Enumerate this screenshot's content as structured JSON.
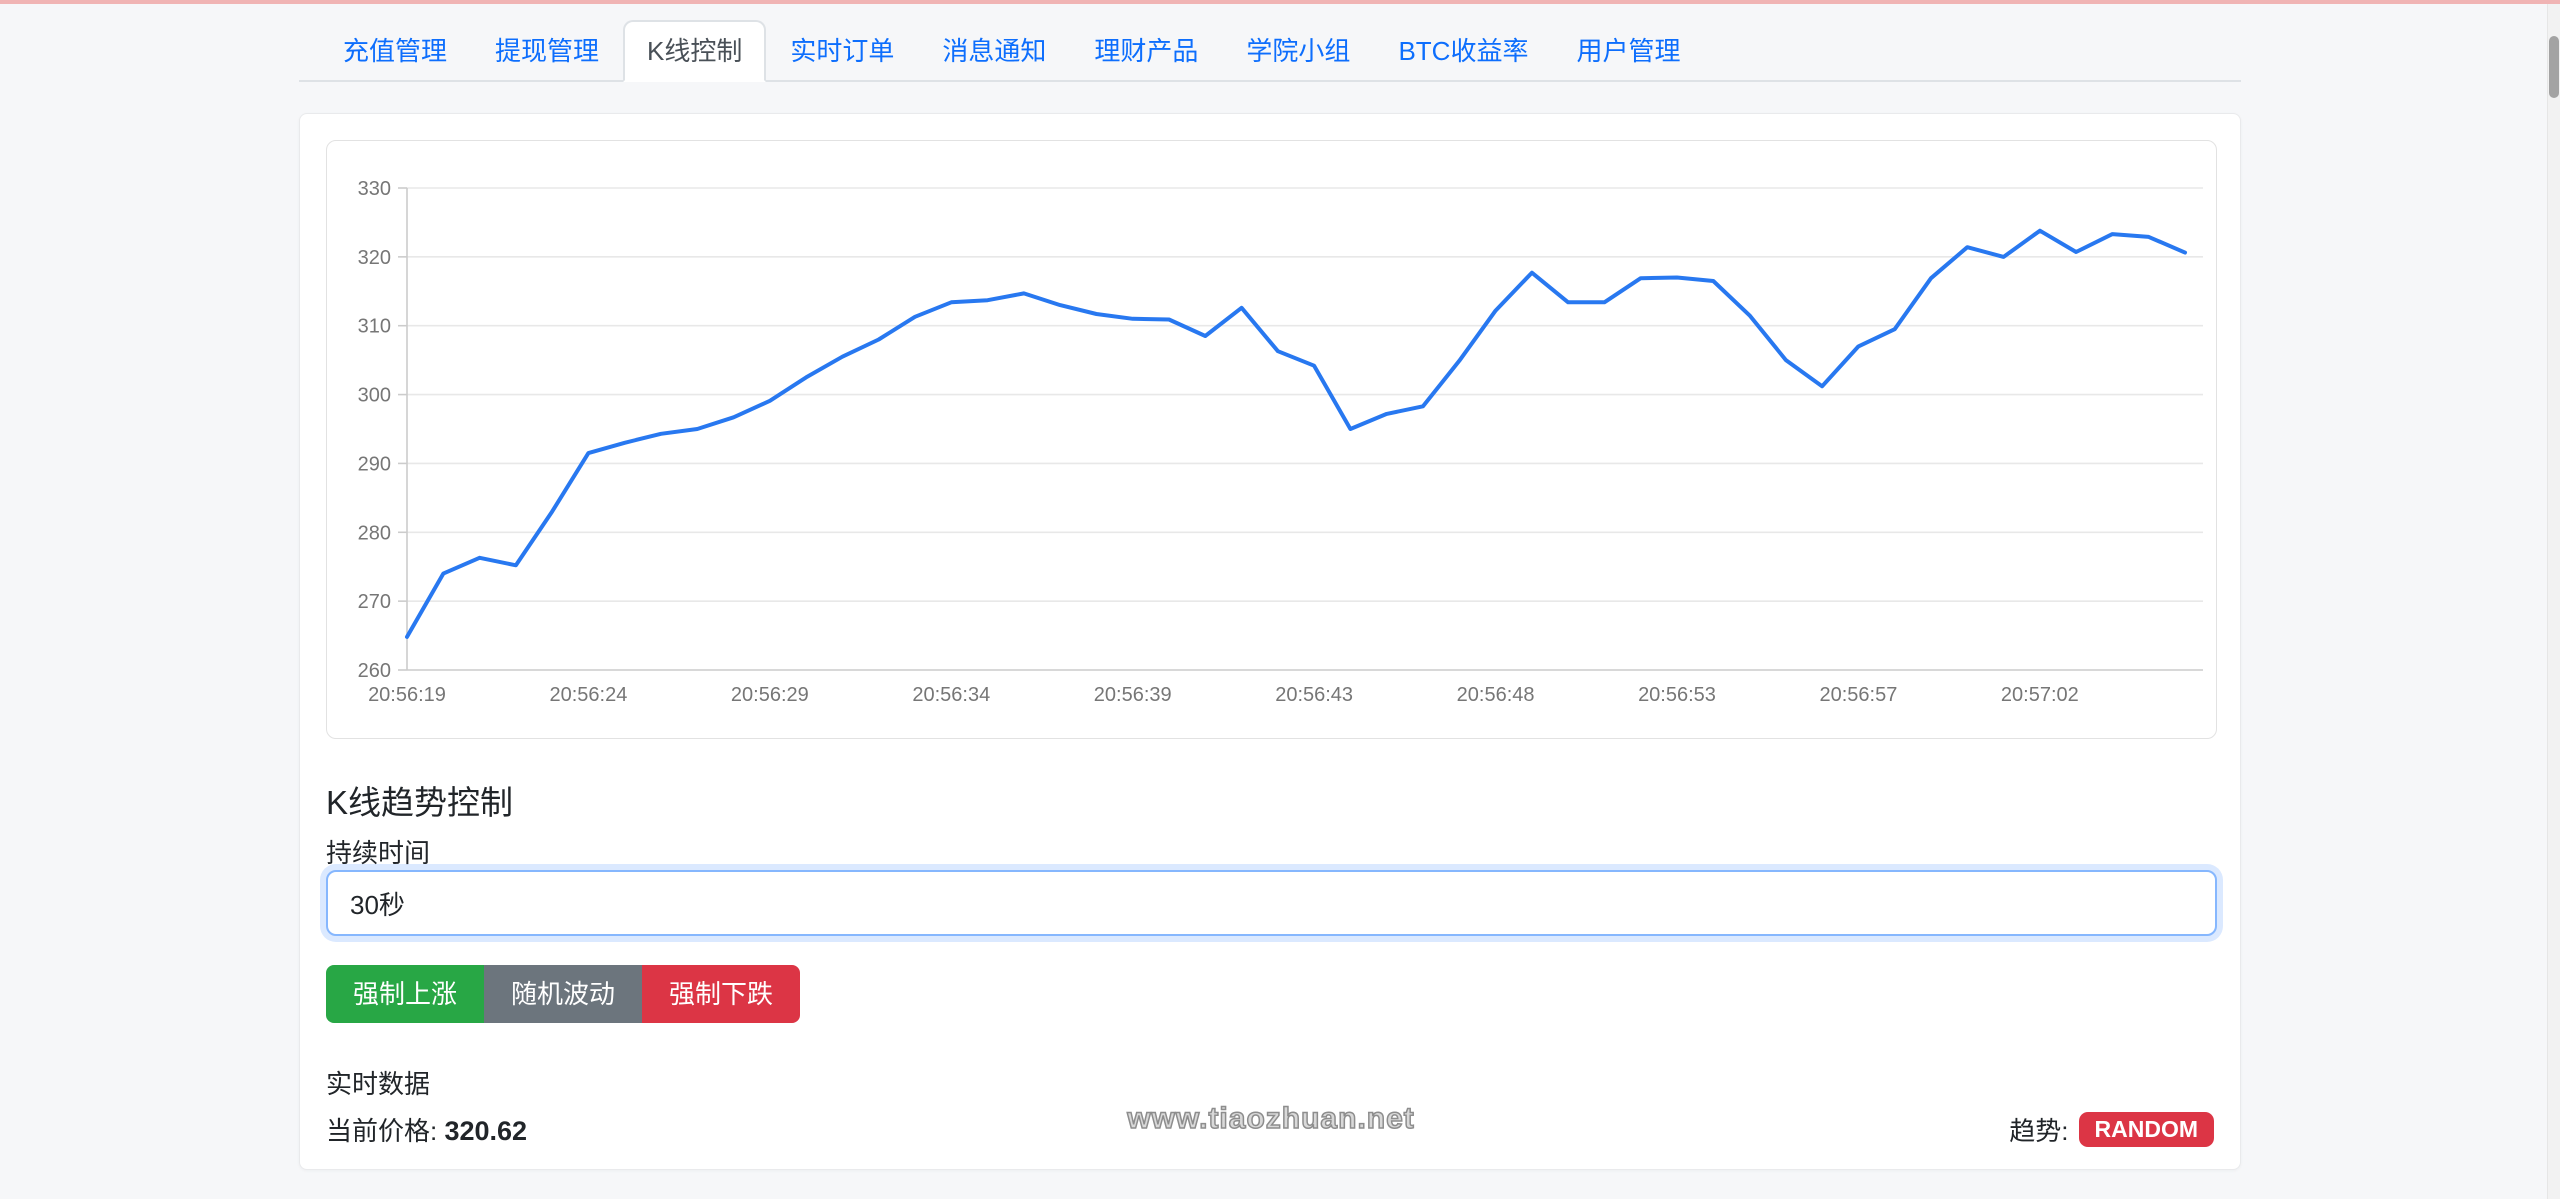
{
  "page": {
    "topbar_color": "#f0b4b4"
  },
  "tabs": {
    "items": [
      {
        "label": "充值管理"
      },
      {
        "label": "提现管理"
      },
      {
        "label": "K线控制"
      },
      {
        "label": "实时订单"
      },
      {
        "label": "消息通知"
      },
      {
        "label": "理财产品"
      },
      {
        "label": "学院小组"
      },
      {
        "label": "BTC收益率"
      },
      {
        "label": "用户管理"
      }
    ],
    "active_index": 2
  },
  "panel": {
    "heading": "K线趋势控制",
    "duration_label": "持续时间",
    "duration_value": "30秒",
    "buttons": [
      {
        "label": "强制上涨",
        "color": "#28a745"
      },
      {
        "label": "随机波动",
        "color": "#6c757d"
      },
      {
        "label": "强制下跌",
        "color": "#dc3545"
      }
    ],
    "realtime_title": "实时数据",
    "price_label": "当前价格:",
    "price_value": "320.62",
    "watermark": "www.tiaozhuan.net",
    "trend_label": "趋势:",
    "trend_value": "RANDOM",
    "trend_badge_color": "#dc3545"
  },
  "chart_data": {
    "type": "line",
    "title": "",
    "xlabel": "",
    "ylabel": "",
    "ylim": [
      260,
      330
    ],
    "y_ticks": [
      330,
      320,
      310,
      300,
      290,
      280,
      270,
      260
    ],
    "grid": "horizontal-only",
    "legend": "none",
    "line_color": "#2878f0",
    "grid_color": "#e8e8e8",
    "axis_color": "#cccccc",
    "label_color": "#767676",
    "x_labels": [
      "20:56:19",
      "20:56:24",
      "20:56:29",
      "20:56:34",
      "20:56:39",
      "20:56:43",
      "20:56:48",
      "20:56:53",
      "20:56:57",
      "20:57:02"
    ],
    "label_every": 5,
    "values": [
      264.8,
      274.0,
      276.3,
      275.2,
      283.0,
      291.5,
      293.0,
      294.3,
      295.0,
      296.7,
      299.1,
      302.5,
      305.5,
      308.0,
      311.3,
      313.4,
      313.7,
      314.7,
      313.0,
      311.7,
      311.0,
      310.9,
      308.5,
      312.6,
      306.3,
      304.2,
      295.0,
      297.2,
      298.3,
      304.9,
      312.2,
      317.7,
      313.4,
      313.4,
      316.9,
      317.0,
      316.5,
      311.5,
      305.0,
      301.2,
      307.0,
      309.5,
      316.9,
      321.4,
      320.0,
      323.8,
      320.7,
      323.3,
      322.9,
      320.62
    ]
  }
}
